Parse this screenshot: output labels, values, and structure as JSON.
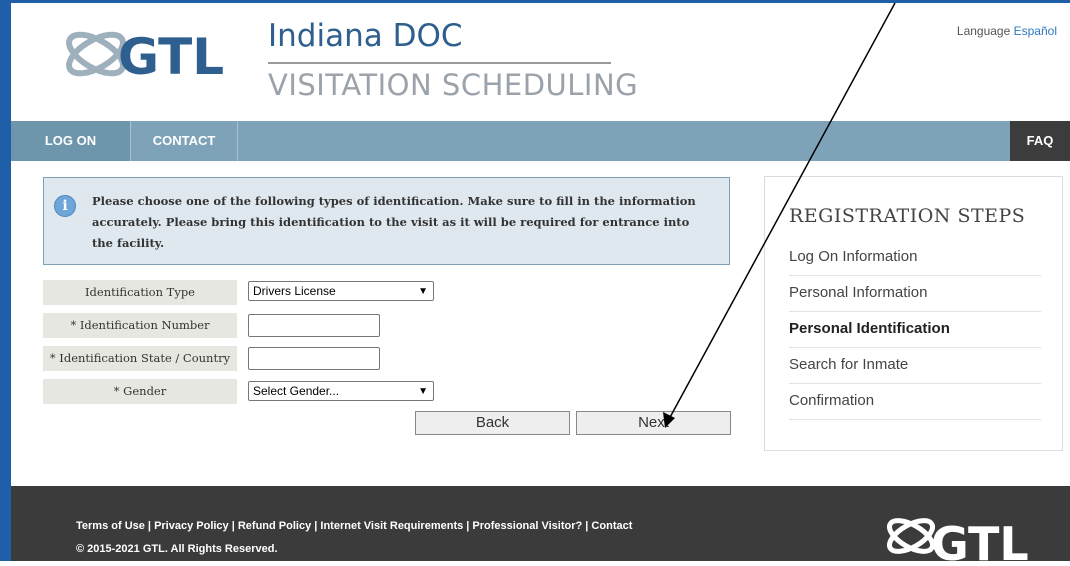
{
  "header": {
    "logo_text": "GTL",
    "title_line1": "Indiana DOC",
    "title_line2": "VISITATION SCHEDULING",
    "language_label": "Language",
    "language_link": "Español"
  },
  "nav": {
    "logon": "LOG ON",
    "contact": "CONTACT",
    "faq": "FAQ"
  },
  "info": {
    "icon": "info-icon",
    "message": "Please choose one of the following types of identification. Make sure to fill in the information accurately. Please bring this identification to the visit as it will be required for entrance into the facility."
  },
  "form": {
    "id_type_label": "Identification Type",
    "id_type_value": "Drivers License",
    "id_number_label": "* Identification Number",
    "id_number_value": "",
    "id_state_label": "* Identification State / Country",
    "id_state_value": "",
    "gender_label": "* Gender",
    "gender_value": "Select Gender...",
    "back_label": "Back",
    "next_label": "Next"
  },
  "steps": {
    "title": "REGISTRATION STEPS",
    "items": [
      {
        "label": "Log On Information",
        "active": false
      },
      {
        "label": "Personal Information",
        "active": false
      },
      {
        "label": "Personal Identification",
        "active": true
      },
      {
        "label": "Search for Inmate",
        "active": false
      },
      {
        "label": "Confirmation",
        "active": false
      }
    ]
  },
  "footer": {
    "links": "Terms of Use | Privacy Policy | Refund Policy | Internet Visit Requirements | Professional Visitor? | Contact",
    "copyright": "© 2015-2021 GTL. All Rights Reserved.",
    "logo_text": "GTL"
  },
  "colors": {
    "frame": "#1f5fa8",
    "navbar": "#7ea3b9",
    "faq": "#3c3c3c",
    "footer": "#3b3b3b",
    "title": "#2e5f8e"
  }
}
